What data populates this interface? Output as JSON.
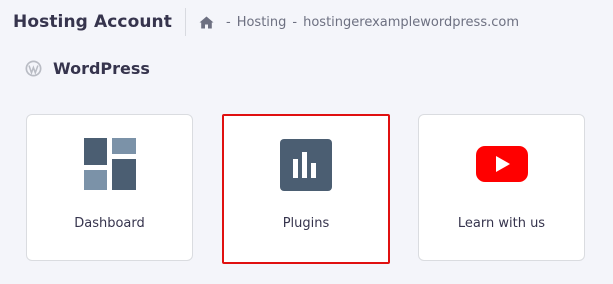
{
  "header": {
    "title": "Hosting Account",
    "breadcrumb": {
      "home_icon": "home-icon",
      "items": [
        "Hosting",
        "hostingerexamplewordpress.com"
      ],
      "separator": "-"
    }
  },
  "section": {
    "icon": "wordpress-icon",
    "title": "WordPress"
  },
  "cards": [
    {
      "label": "Dashboard",
      "icon": "dashboard-grid-icon"
    },
    {
      "label": "Plugins",
      "icon": "plugins-bar-icon"
    },
    {
      "label": "Learn with us",
      "icon": "youtube-play-icon"
    }
  ],
  "colors": {
    "accent": "#4b5e72",
    "highlight_border": "#e01010",
    "youtube_red": "#ff0000"
  }
}
